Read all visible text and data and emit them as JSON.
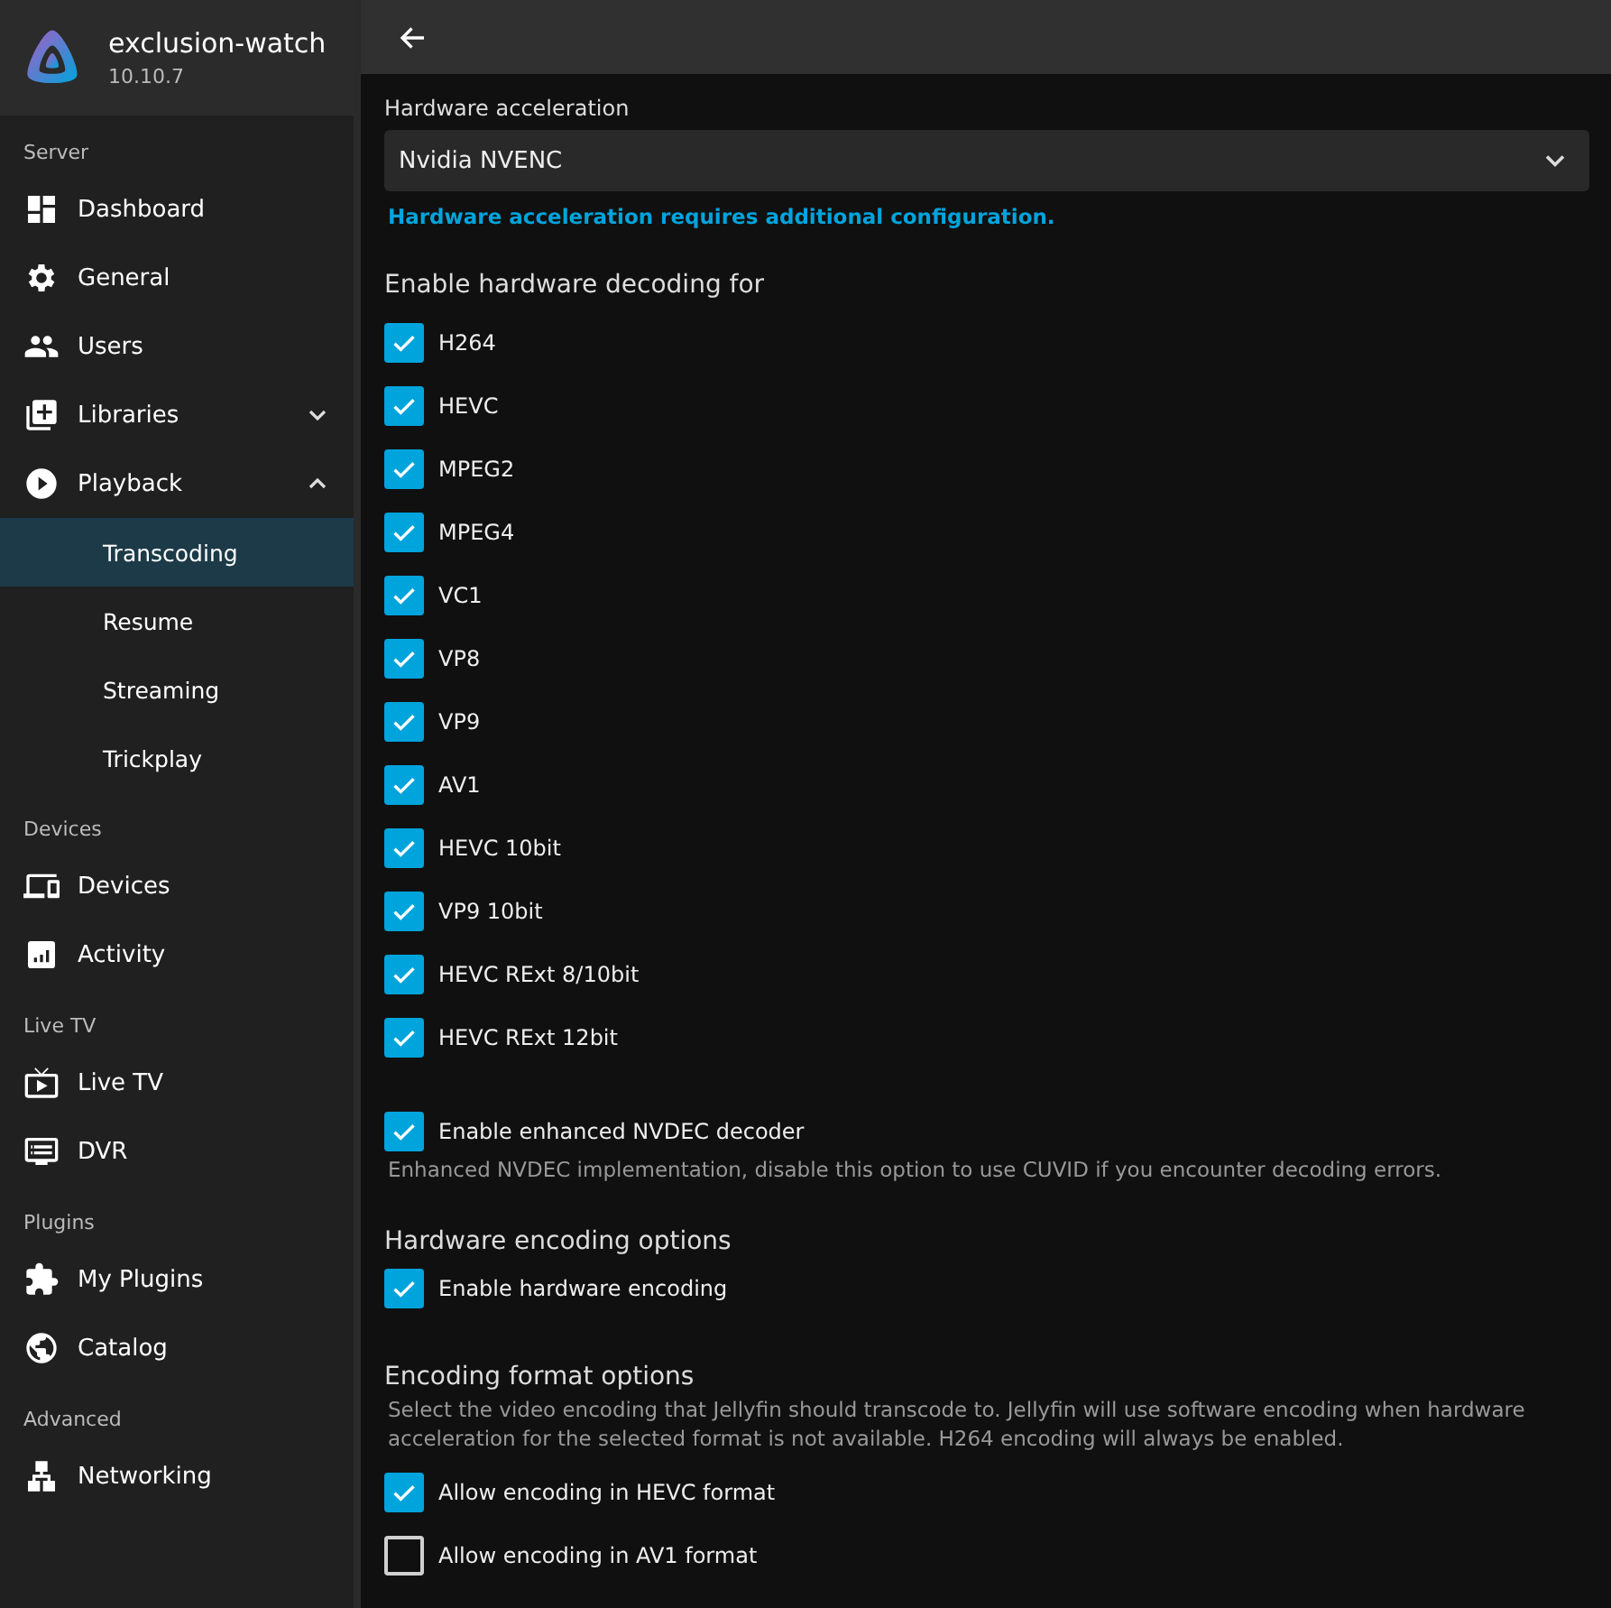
{
  "app": {
    "name": "exclusion-watch",
    "version": "10.10.7"
  },
  "sidebar": {
    "sections": [
      {
        "title": "Server",
        "items": [
          {
            "label": "Dashboard",
            "selected": false
          },
          {
            "label": "General",
            "selected": false
          },
          {
            "label": "Users",
            "selected": false
          },
          {
            "label": "Libraries",
            "selected": false,
            "expanded": false
          },
          {
            "label": "Playback",
            "selected": false,
            "expanded": true,
            "children": [
              {
                "label": "Transcoding",
                "selected": true
              },
              {
                "label": "Resume",
                "selected": false
              },
              {
                "label": "Streaming",
                "selected": false
              },
              {
                "label": "Trickplay",
                "selected": false
              }
            ]
          }
        ]
      },
      {
        "title": "Devices",
        "items": [
          {
            "label": "Devices",
            "selected": false
          },
          {
            "label": "Activity",
            "selected": false
          }
        ]
      },
      {
        "title": "Live TV",
        "items": [
          {
            "label": "Live TV",
            "selected": false
          },
          {
            "label": "DVR",
            "selected": false
          }
        ]
      },
      {
        "title": "Plugins",
        "items": [
          {
            "label": "My Plugins",
            "selected": false
          },
          {
            "label": "Catalog",
            "selected": false
          }
        ]
      },
      {
        "title": "Advanced",
        "items": [
          {
            "label": "Networking",
            "selected": false
          }
        ]
      }
    ]
  },
  "main": {
    "hardware_acceleration": {
      "label": "Hardware acceleration",
      "value": "Nvidia NVENC",
      "note": "Hardware acceleration requires additional configuration."
    },
    "decoding": {
      "title": "Enable hardware decoding for",
      "options": [
        {
          "label": "H264",
          "checked": true
        },
        {
          "label": "HEVC",
          "checked": true
        },
        {
          "label": "MPEG2",
          "checked": true
        },
        {
          "label": "MPEG4",
          "checked": true
        },
        {
          "label": "VC1",
          "checked": true
        },
        {
          "label": "VP8",
          "checked": true
        },
        {
          "label": "VP9",
          "checked": true
        },
        {
          "label": "AV1",
          "checked": true
        },
        {
          "label": "HEVC 10bit",
          "checked": true
        },
        {
          "label": "VP9 10bit",
          "checked": true
        },
        {
          "label": "HEVC RExt 8/10bit",
          "checked": true
        },
        {
          "label": "HEVC RExt 12bit",
          "checked": true
        }
      ]
    },
    "nvdec": {
      "label": "Enable enhanced NVDEC decoder",
      "checked": true,
      "help": "Enhanced NVDEC implementation, disable this option to use CUVID if you encounter decoding errors."
    },
    "encoding": {
      "title": "Hardware encoding options",
      "options": [
        {
          "label": "Enable hardware encoding",
          "checked": true
        }
      ]
    },
    "formats": {
      "title": "Encoding format options",
      "help": "Select the video encoding that Jellyfin should transcode to. Jellyfin will use software encoding when hardware acceleration for the selected format is not available. H264 encoding will always be enabled.",
      "options": [
        {
          "label": "Allow encoding in HEVC format",
          "checked": true
        },
        {
          "label": "Allow encoding in AV1 format",
          "checked": false
        }
      ]
    }
  }
}
